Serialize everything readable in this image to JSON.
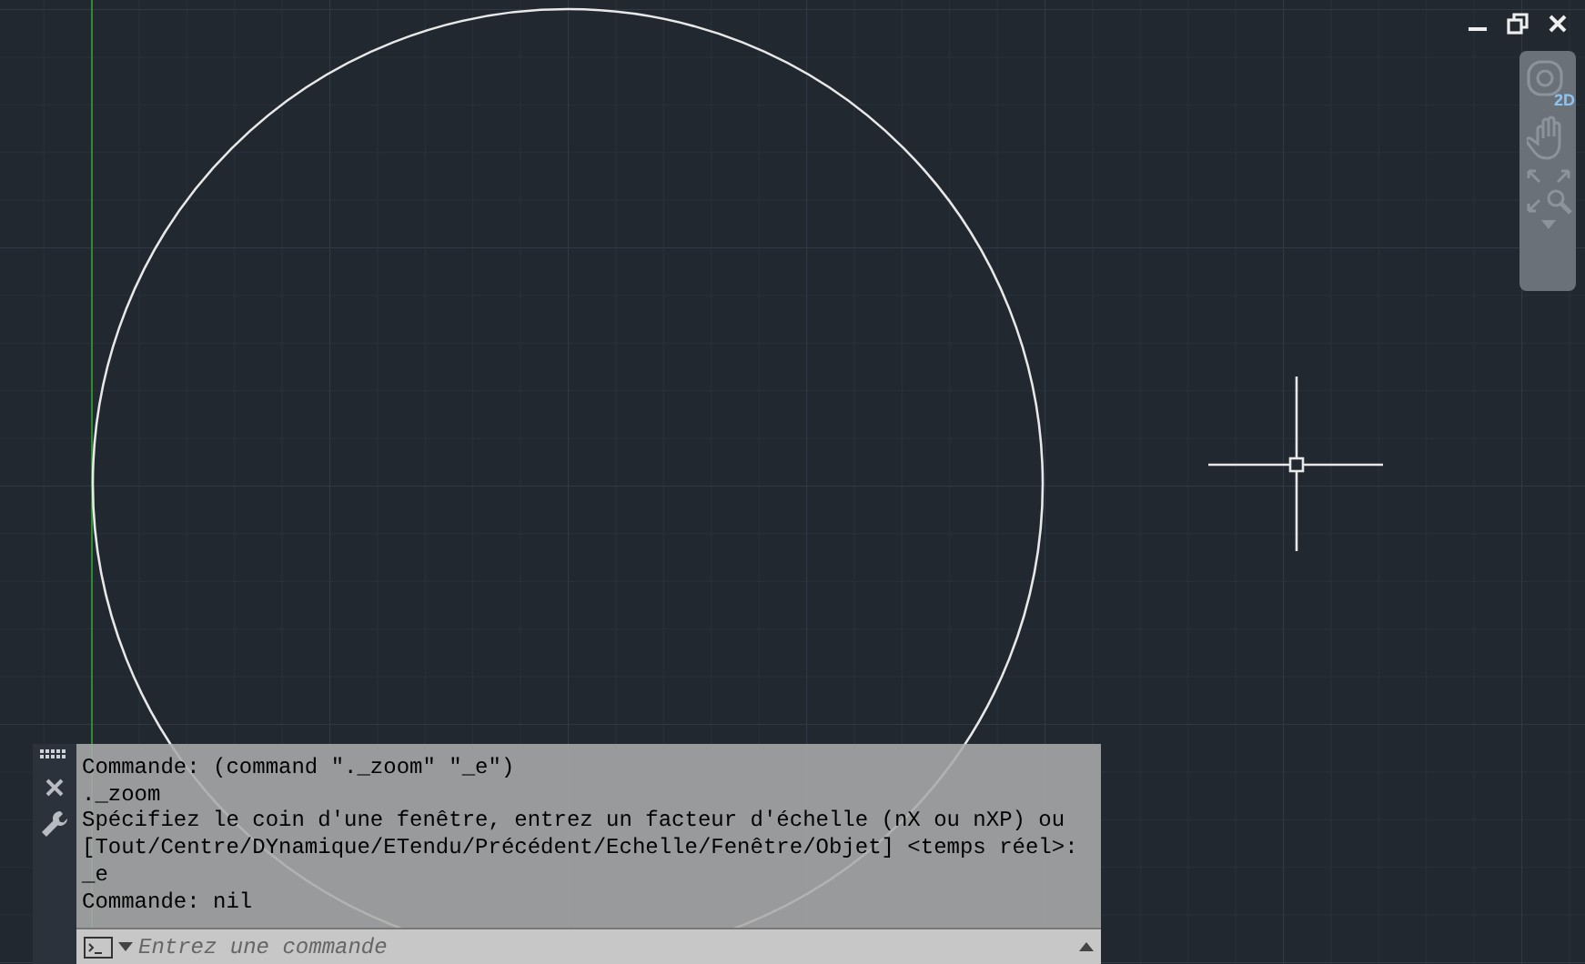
{
  "navigation_bar": {
    "wheel_label": "2D"
  },
  "command_window": {
    "history": [
      "Commande: (command \"._zoom\" \"_e\")",
      "._zoom",
      "Spécifiez le coin d'une fenêtre, entrez un facteur d'échelle (nX ou nXP) ou",
      "[Tout/Centre/DYnamique/ETendu/Précédent/Echelle/Fenêtre/Objet] <temps réel>:",
      "_e",
      "Commande: nil"
    ],
    "input": {
      "placeholder": "Entrez une commande"
    }
  }
}
